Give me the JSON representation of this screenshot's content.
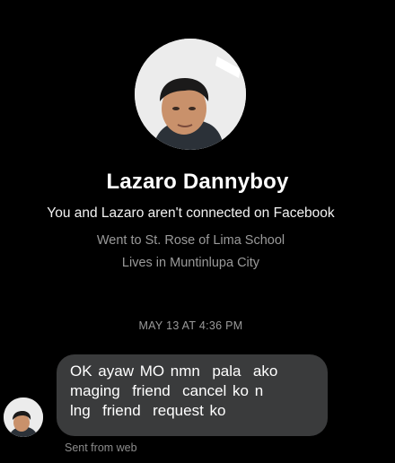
{
  "profile": {
    "name": "Lazaro Dannyboy",
    "connection_note": "You and Lazaro aren't connected on Facebook",
    "details": [
      "Went to St. Rose of Lima School",
      "Lives in Muntinlupa City"
    ]
  },
  "conversation": {
    "timestamp": "MAY 13 AT 4:36 PM",
    "message": {
      "lines": [
        "OK ayaw MO nmn  pala  ako",
        "maging  friend  cancel ko n",
        "lng  friend  request ko"
      ],
      "footer": "Sent from web"
    }
  },
  "colors": {
    "background": "#000000",
    "bubble": "#3a3b3c",
    "primary_text": "#ffffff",
    "secondary_text": "#9a9a9a"
  }
}
